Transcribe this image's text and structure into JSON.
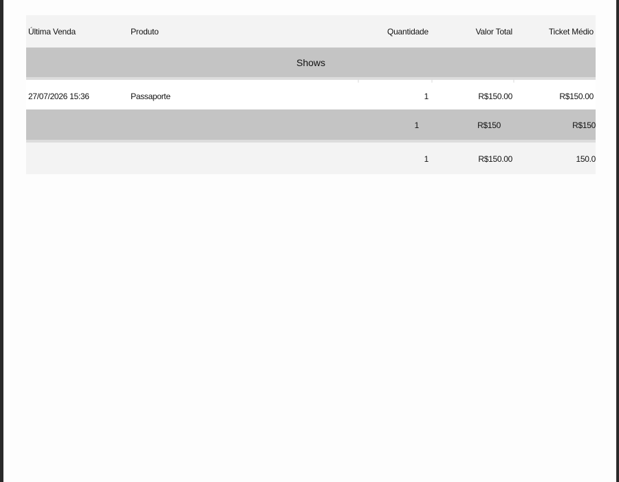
{
  "report": {
    "columns": {
      "last_sale": "Última Venda",
      "product": "Produto",
      "quantity": "Quantidade",
      "total_value": "Valor Total",
      "avg_ticket": "Ticket Médio"
    },
    "group": {
      "title": "Shows",
      "rows": [
        {
          "last_sale": "27/07/2026 15:36",
          "product": "Passaporte",
          "quantity": "1",
          "total_value": "R$150.00",
          "avg_ticket": "R$150.00"
        }
      ],
      "subtotal": {
        "quantity": "1",
        "total_value": "R$150",
        "avg_ticket": "R$150"
      }
    },
    "total": {
      "quantity": "1",
      "total_value": "R$150.00",
      "avg_ticket": "150.0"
    }
  }
}
